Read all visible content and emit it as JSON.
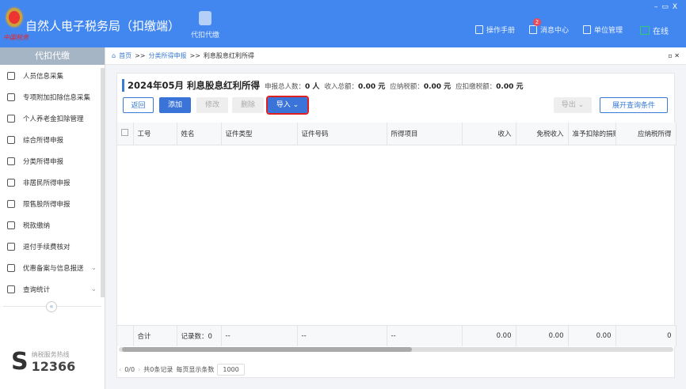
{
  "app": {
    "title": "自然人电子税务局（扣缴端）",
    "brand_sub": "中国税务",
    "module_tab": "代扣代缴",
    "top_links": [
      {
        "label": "操作手册",
        "icon": "manual-icon"
      },
      {
        "label": "消息中心",
        "icon": "mail-icon",
        "badge": "2"
      },
      {
        "label": "单位管理",
        "icon": "building-icon"
      },
      {
        "label": "在线",
        "icon": "monitor-check-icon"
      }
    ]
  },
  "sidebar": {
    "header": "代扣代缴",
    "items": [
      {
        "label": "人员信息采集"
      },
      {
        "label": "专项附加扣除信息采集"
      },
      {
        "label": "个人养老金扣除管理"
      },
      {
        "label": "综合所得申报"
      },
      {
        "label": "分类所得申报"
      },
      {
        "label": "非居民所得申报"
      },
      {
        "label": "限售股所得申报"
      },
      {
        "label": "税款缴纳"
      },
      {
        "label": "退付手续费核对"
      },
      {
        "label": "优惠备案与信息报送",
        "expand": true
      },
      {
        "label": "查询统计",
        "expand": true
      }
    ],
    "hotline_label": "纳税服务热线",
    "hotline_number": "12366"
  },
  "breadcrumb": {
    "home": "首页",
    "sep": ">>",
    "parent": "分类所得申报",
    "current": "利息股息红利所得"
  },
  "summary": {
    "title": "2024年05月 利息股息红利所得",
    "count_label": "申报总人数：",
    "count": "0 人",
    "income_label": "收入总额：",
    "income": "0.00 元",
    "tax_label": "应纳税额：",
    "tax": "0.00 元",
    "withhold_label": "应扣缴税额：",
    "withhold": "0.00 元"
  },
  "toolbar": {
    "back": "返回",
    "add": "添加",
    "edit": "修改",
    "delete": "删除",
    "import": "导入",
    "export": "导出",
    "expand_query": "展开查询条件"
  },
  "table": {
    "columns": [
      "工号",
      "姓名",
      "证件类型",
      "证件号码",
      "所得项目",
      "收入",
      "免税收入",
      "准予扣除的捐赠额",
      "应纳税所得"
    ],
    "footer": [
      "合计",
      "记录数：0",
      "--",
      "--",
      "--",
      "0.00",
      "0.00",
      "0.00",
      "0"
    ]
  },
  "pager": {
    "page": "0/0",
    "total": "共0条记录",
    "page_size_label": "每页显示条数",
    "page_size": "1000"
  },
  "colors": {
    "header_blue": "#4287f0",
    "primary": "#3a74d8",
    "highlight": "#e02020"
  }
}
